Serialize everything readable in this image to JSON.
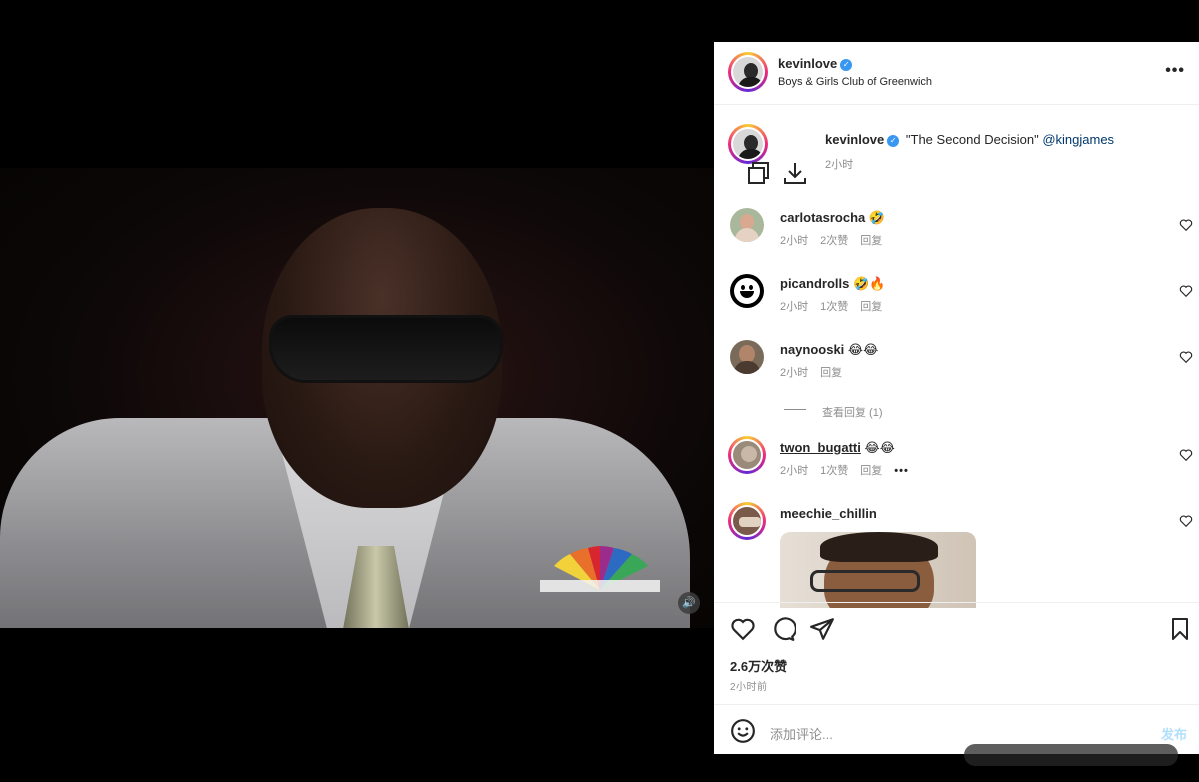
{
  "video": {
    "volume_icon": "speaker-icon",
    "logo": "nbc-peacock-logo"
  },
  "header": {
    "username": "kevinlove",
    "location": "Boys & Girls Club of Greenwich",
    "more_icon": "more-horizontal-icon"
  },
  "caption": {
    "username": "kevinlove",
    "text": "\"The Second Decision\"",
    "mention": "@kingjames",
    "time": "2小时"
  },
  "comments": [
    {
      "user": "carlotasrocha",
      "emoji": "🤣",
      "time": "2小时",
      "likes": "2次赞",
      "reply": "回复",
      "avatar_color": "#9aa88a"
    },
    {
      "user": "picandrolls",
      "emoji": "🤣🔥",
      "time": "2小时",
      "likes": "1次赞",
      "reply": "回复",
      "avatar_color": "#000000"
    },
    {
      "user": "naynooski",
      "emoji": "😂😂",
      "time": "2小时",
      "likes": "",
      "reply": "回复",
      "avatar_color": "#6a5a4a"
    },
    {
      "user": "twon_bugatti",
      "emoji": "😂😂",
      "time": "2小时",
      "likes": "1次赞",
      "reply": "回复",
      "avatar_color": "#8a7a6a"
    },
    {
      "user": "meechie_chillin",
      "emoji": "",
      "time": "",
      "likes": "",
      "reply": "",
      "avatar_color": "#7a5a4a"
    }
  ],
  "view_replies": "查看回复 (1)",
  "actions": {
    "like_icon": "heart-icon",
    "comment_icon": "comment-icon",
    "share_icon": "send-icon",
    "save_icon": "bookmark-icon"
  },
  "likes": "2.6万次赞",
  "posted": "2小时前",
  "add_comment": {
    "placeholder": "添加评论...",
    "post_label": "发布",
    "emoji_icon": "smiley-icon"
  }
}
